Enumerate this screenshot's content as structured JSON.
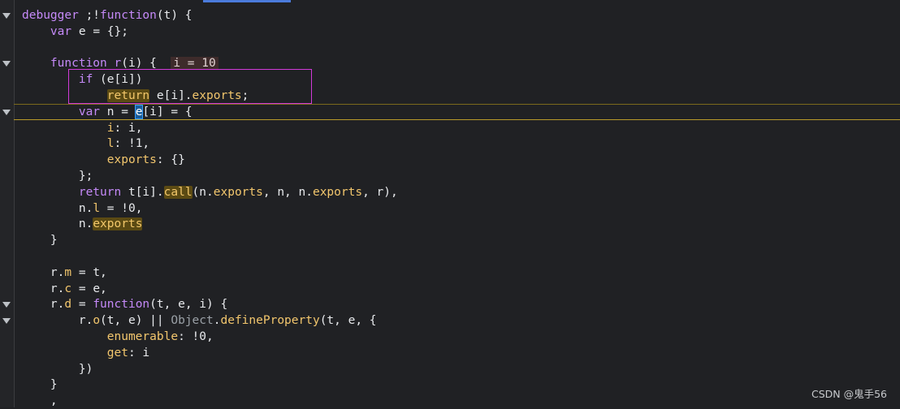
{
  "editor": {
    "lines": [
      {
        "id": "l1",
        "segments": [
          {
            "t": "debugger",
            "c": "kw"
          },
          {
            "t": " ;!"
          },
          {
            "t": "function",
            "c": "kw"
          },
          {
            "t": "(t) {"
          }
        ]
      },
      {
        "id": "l2",
        "segments": [
          {
            "t": "    "
          },
          {
            "t": "var",
            "c": "kw"
          },
          {
            "t": " e = {};"
          }
        ]
      },
      {
        "id": "l3",
        "segments": []
      },
      {
        "id": "l4",
        "segments": [
          {
            "t": "    "
          },
          {
            "t": "function",
            "c": "kw"
          },
          {
            "t": " "
          },
          {
            "t": "r",
            "c": "fn"
          },
          {
            "t": "(i) {  "
          },
          {
            "t": "i = 10",
            "c": "inline-val"
          }
        ]
      },
      {
        "id": "l5",
        "segments": [
          {
            "t": "        "
          },
          {
            "t": "if",
            "c": "kw"
          },
          {
            "t": " (e[i])"
          }
        ]
      },
      {
        "id": "l6",
        "segments": [
          {
            "t": "            "
          },
          {
            "t": "return",
            "c": "hl"
          },
          {
            "t": " e[i]."
          },
          {
            "t": "exports",
            "c": "method"
          },
          {
            "t": ";"
          }
        ]
      },
      {
        "id": "l7",
        "segments": [
          {
            "t": "        "
          },
          {
            "t": "var",
            "c": "kw"
          },
          {
            "t": " n = "
          },
          {
            "t": "e",
            "c": "cursor"
          },
          {
            "t": "[i] = {"
          }
        ]
      },
      {
        "id": "l8",
        "segments": [
          {
            "t": "            "
          },
          {
            "t": "i",
            "c": "method"
          },
          {
            "t": ": i,"
          }
        ]
      },
      {
        "id": "l9",
        "segments": [
          {
            "t": "            "
          },
          {
            "t": "l",
            "c": "method"
          },
          {
            "t": ": !1,"
          }
        ]
      },
      {
        "id": "l10",
        "segments": [
          {
            "t": "            "
          },
          {
            "t": "exports",
            "c": "method"
          },
          {
            "t": ": {}"
          }
        ]
      },
      {
        "id": "l11",
        "segments": [
          {
            "t": "        };"
          }
        ]
      },
      {
        "id": "l12",
        "segments": [
          {
            "t": "        "
          },
          {
            "t": "return",
            "c": "kw"
          },
          {
            "t": " t[i]."
          },
          {
            "t": "call",
            "c": "hl"
          },
          {
            "t": "(n."
          },
          {
            "t": "exports",
            "c": "method"
          },
          {
            "t": ", n, n."
          },
          {
            "t": "exports",
            "c": "method"
          },
          {
            "t": ", r),"
          }
        ]
      },
      {
        "id": "l13",
        "segments": [
          {
            "t": "        n."
          },
          {
            "t": "l",
            "c": "method"
          },
          {
            "t": " = !0,"
          }
        ]
      },
      {
        "id": "l14",
        "segments": [
          {
            "t": "        n."
          },
          {
            "t": "exports",
            "c": "hl"
          }
        ]
      },
      {
        "id": "l15",
        "segments": [
          {
            "t": "    }"
          }
        ]
      },
      {
        "id": "l16",
        "segments": []
      },
      {
        "id": "l17",
        "segments": [
          {
            "t": "    r."
          },
          {
            "t": "m",
            "c": "method"
          },
          {
            "t": " = t,"
          }
        ]
      },
      {
        "id": "l18",
        "segments": [
          {
            "t": "    r."
          },
          {
            "t": "c",
            "c": "method"
          },
          {
            "t": " = e,"
          }
        ]
      },
      {
        "id": "l19",
        "segments": [
          {
            "t": "    r."
          },
          {
            "t": "d",
            "c": "method"
          },
          {
            "t": " = "
          },
          {
            "t": "function",
            "c": "kw"
          },
          {
            "t": "(t, e, i) {"
          }
        ]
      },
      {
        "id": "l20",
        "segments": [
          {
            "t": "        r."
          },
          {
            "t": "o",
            "c": "method"
          },
          {
            "t": "(t, e) || "
          },
          {
            "t": "Object",
            "c": "obj"
          },
          {
            "t": "."
          },
          {
            "t": "defineProperty",
            "c": "method"
          },
          {
            "t": "(t, e, {"
          }
        ]
      },
      {
        "id": "l21",
        "segments": [
          {
            "t": "            "
          },
          {
            "t": "enumerable",
            "c": "method"
          },
          {
            "t": ": !0,"
          }
        ]
      },
      {
        "id": "l22",
        "segments": [
          {
            "t": "            "
          },
          {
            "t": "get",
            "c": "method"
          },
          {
            "t": ": i"
          }
        ]
      },
      {
        "id": "l23",
        "segments": [
          {
            "t": "        })"
          }
        ]
      },
      {
        "id": "l24",
        "segments": [
          {
            "t": "    }"
          }
        ]
      },
      {
        "id": "l25",
        "segments": [
          {
            "t": "    ,"
          }
        ]
      }
    ],
    "fold_markers": [
      "l1",
      "l4",
      "l7",
      "l19",
      "l20"
    ]
  },
  "watermark": "CSDN @鬼手56",
  "colors": {
    "background": "#202124",
    "keyword": "#c58af9",
    "highlight_bg": "#5b4a13",
    "property": "#f2c66d",
    "selection_box": "#d23ad9",
    "paused_line": "#b99b2a"
  }
}
